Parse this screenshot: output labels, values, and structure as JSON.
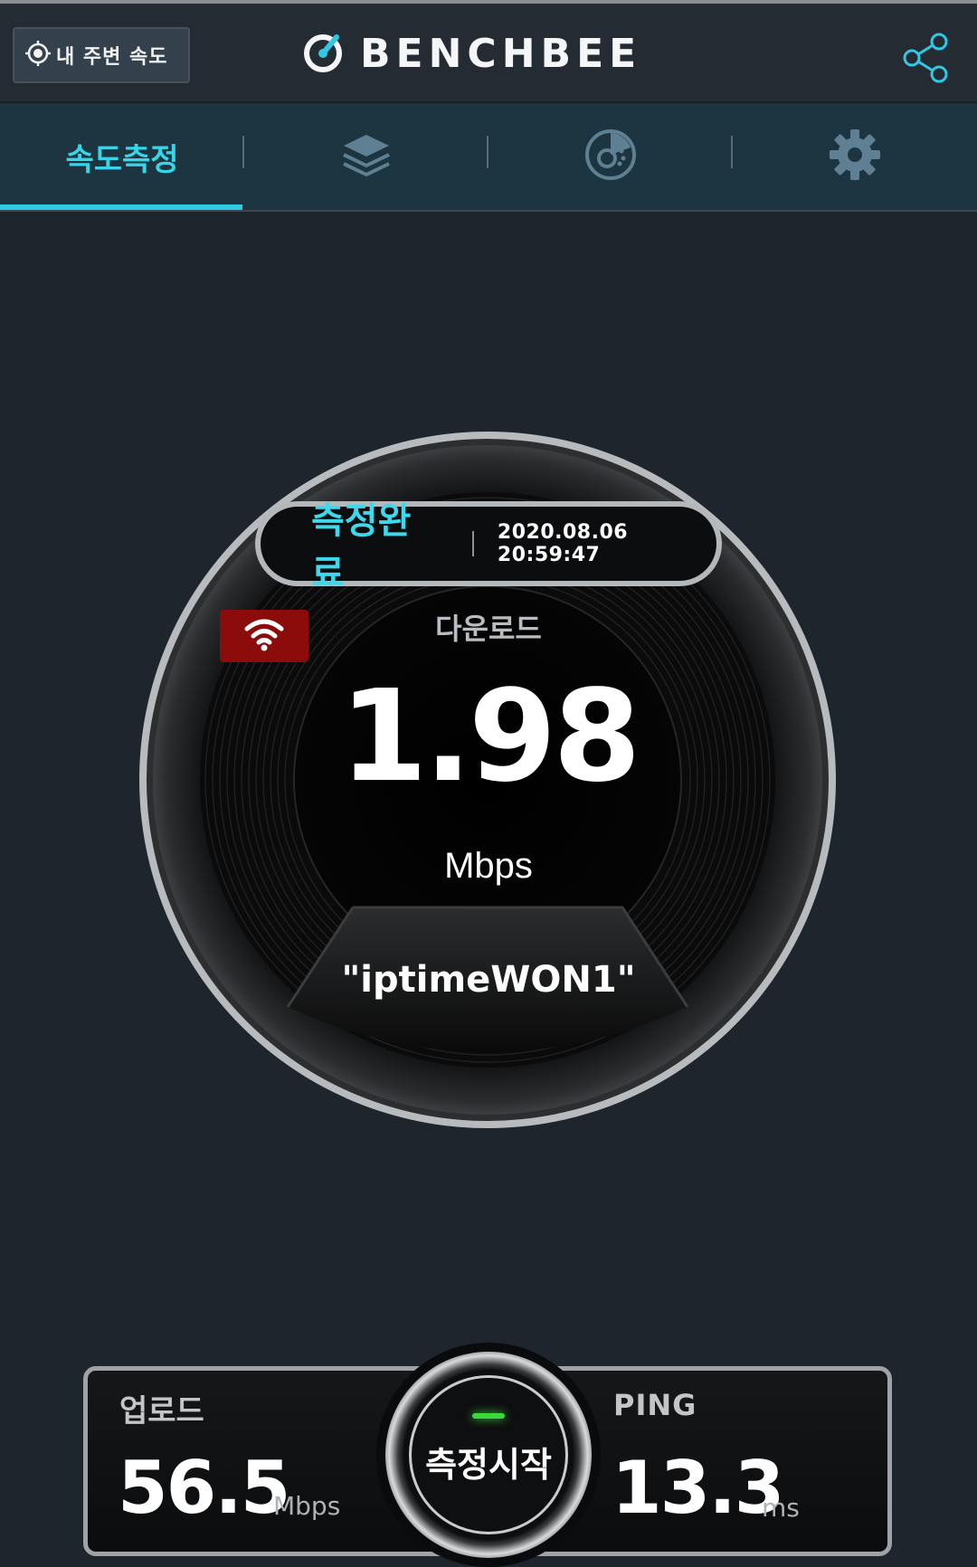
{
  "header": {
    "nearby_label": "내 주변 속도",
    "logo_text": "BENCHBEE",
    "share_icon": "share-icon",
    "accent": "#2fc9e3"
  },
  "tabs": [
    {
      "label": "속도측정",
      "icon": null,
      "active": true
    },
    {
      "label": "",
      "icon": "layers-icon",
      "active": false
    },
    {
      "label": "",
      "icon": "stats-pie-icon",
      "active": false
    },
    {
      "label": "",
      "icon": "gear-icon",
      "active": false
    }
  ],
  "gauge": {
    "status_label": "측정완료",
    "timestamp": "2020.08.06 20:59:47",
    "connection_icon": "wifi-icon",
    "connection_badge_color": "#8c0b0b",
    "download_label": "다운로드",
    "download_value": "1.98",
    "download_unit": "Mbps",
    "ssid": "\"iptimeWON1\""
  },
  "results": {
    "upload_label": "업로드",
    "upload_value": "56.5",
    "upload_unit": "Mbps",
    "ping_label": "PING",
    "ping_value": "13.3",
    "ping_unit": "ms",
    "start_label": "측정시작",
    "start_led_color": "#3bd93b"
  }
}
